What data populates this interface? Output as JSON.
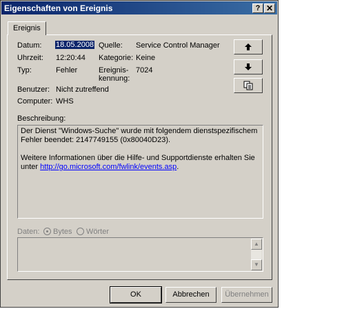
{
  "window": {
    "title": "Eigenschaften von Ereignis",
    "help_glyph": "?",
    "close_glyph": "✕"
  },
  "tab": {
    "label": "Ereignis"
  },
  "fields": {
    "datum_label": "Datum:",
    "datum_value": "18.05.2008",
    "uhrzeit_label": "Uhrzeit:",
    "uhrzeit_value": "12:20:44",
    "typ_label": "Typ:",
    "typ_value": "Fehler",
    "benutzer_label": "Benutzer:",
    "benutzer_value": "Nicht zutreffend",
    "computer_label": "Computer:",
    "computer_value": "WHS",
    "quelle_label": "Quelle:",
    "quelle_value": "Service Control Manager",
    "kategorie_label": "Kategorie:",
    "kategorie_value": "Keine",
    "kennung_label_1": "Ereignis-",
    "kennung_label_2": "kennung:",
    "kennung_value": "7024"
  },
  "side_buttons": {
    "up_glyph": "🡅",
    "down_glyph": "🡇",
    "copy_glyph": "⧉"
  },
  "description": {
    "label": "Beschreibung:",
    "line1": "Der Dienst \"Windows-Suche\" wurde mit folgendem dienstspezifischem",
    "line2": "Fehler beendet: 2147749155 (0x80040D23).",
    "line3": "Weitere Informationen über die Hilfe- und Supportdienste erhalten Sie",
    "line4_prefix": "unter ",
    "link": "http://go.microsoft.com/fwlink/events.asp",
    "line4_suffix": "."
  },
  "data_section": {
    "label": "Daten:",
    "bytes": "Bytes",
    "woerter": "Wörter",
    "selected": "Bytes"
  },
  "buttons": {
    "ok": "OK",
    "cancel": "Abbrechen",
    "apply": "Übernehmen"
  }
}
